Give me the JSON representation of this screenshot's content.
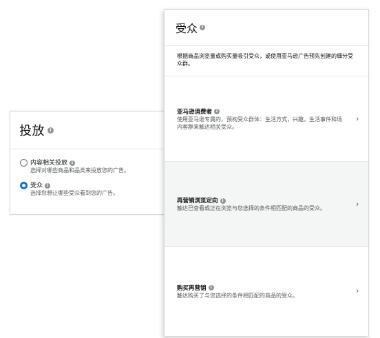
{
  "targeting": {
    "title": "投放",
    "options": [
      {
        "label": "内容相关投放",
        "desc": "选择对哪些商品和品类来投放您的广告。",
        "checked": false
      },
      {
        "label": "受众",
        "desc": "选择您想让哪些受众看到您的广告。",
        "checked": true
      }
    ]
  },
  "audience": {
    "title": "受众",
    "intro": "根据商品浏览量或购买量吸引受众，或使用亚马逊广告预先创建的细分受众群。",
    "items": [
      {
        "title": "亚马逊消费者",
        "desc": "使用亚马逊专属的，预构受众群体：生活方式，兴趣，生活事件和场内客群来触达相关受众。"
      },
      {
        "title": "再营销浏览定向",
        "desc": "触达已查看或正在浏览与您选择的条件相匹配的商品的受众。"
      },
      {
        "title": "购买再营销",
        "desc": "触达购买了与您选择的条件相匹配的商品的受众。"
      }
    ]
  },
  "icons": {
    "info": "info-icon",
    "chevron": "chevron-right-icon"
  },
  "colors": {
    "accent": "#1a73c8",
    "border": "#d5d9d9",
    "shaded_row": "#f4f5f5"
  }
}
